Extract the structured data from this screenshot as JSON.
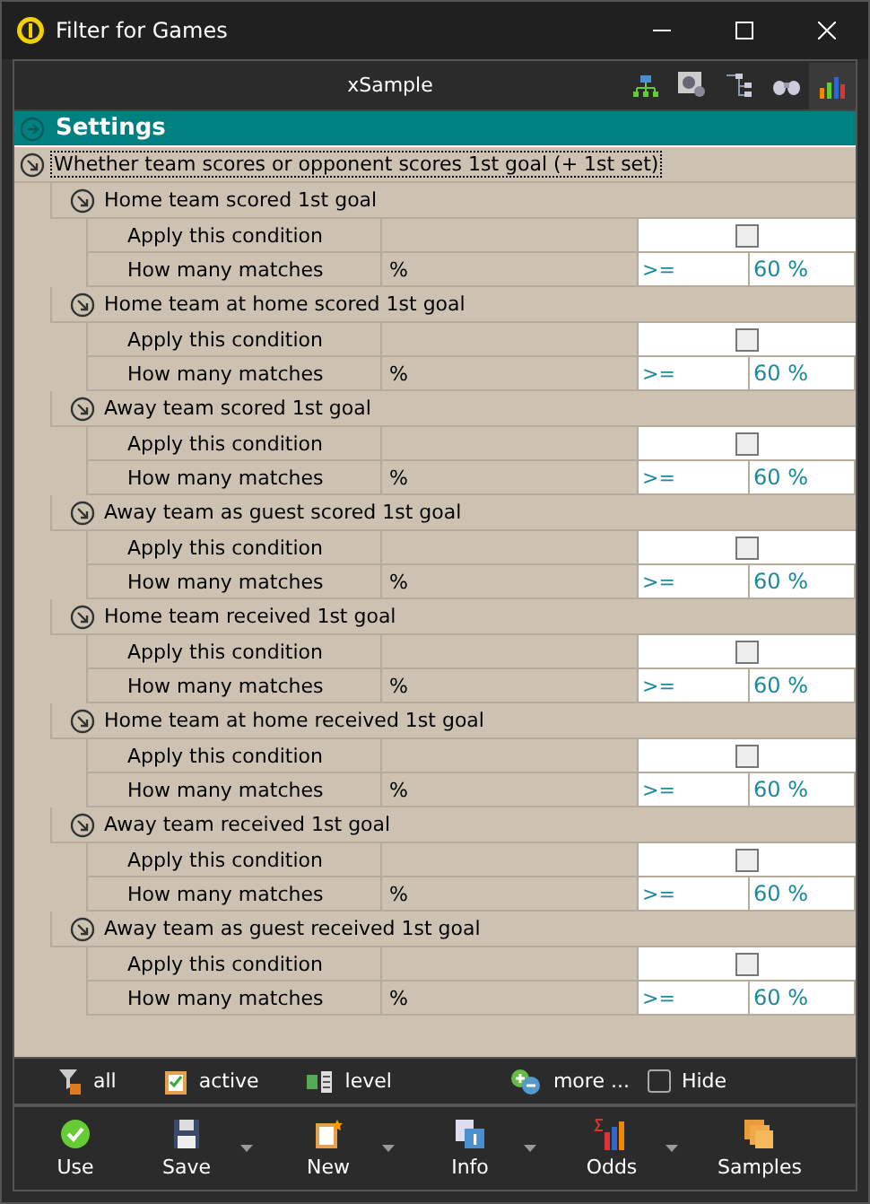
{
  "window": {
    "title": "Filter for Games"
  },
  "toolbar": {
    "title": "xSample"
  },
  "settings": {
    "title": "Settings",
    "group": {
      "title": "Whether team scores or opponent scores 1st goal (+ 1st set)",
      "conditions": [
        {
          "title": "Home team scored 1st goal",
          "apply_label": "Apply this condition",
          "checked": false,
          "matches_label": "How many matches",
          "unit": "%",
          "operator": ">=",
          "value": "60 %"
        },
        {
          "title": "Home team at home scored 1st goal",
          "apply_label": "Apply this condition",
          "checked": false,
          "matches_label": "How many matches",
          "unit": "%",
          "operator": ">=",
          "value": "60 %"
        },
        {
          "title": "Away team scored 1st goal",
          "apply_label": "Apply this condition",
          "checked": false,
          "matches_label": "How many matches",
          "unit": "%",
          "operator": ">=",
          "value": "60 %"
        },
        {
          "title": "Away team as guest scored 1st goal",
          "apply_label": "Apply this condition",
          "checked": false,
          "matches_label": "How many matches",
          "unit": "%",
          "operator": ">=",
          "value": "60 %"
        },
        {
          "title": "Home team received 1st goal",
          "apply_label": "Apply this condition",
          "checked": false,
          "matches_label": "How many matches",
          "unit": "%",
          "operator": ">=",
          "value": "60 %"
        },
        {
          "title": "Home team at home received 1st goal",
          "apply_label": "Apply this condition",
          "checked": false,
          "matches_label": "How many matches",
          "unit": "%",
          "operator": ">=",
          "value": "60 %"
        },
        {
          "title": "Away team received 1st goal",
          "apply_label": "Apply this condition",
          "checked": false,
          "matches_label": "How many matches",
          "unit": "%",
          "operator": ">=",
          "value": "60 %"
        },
        {
          "title": "Away team as guest received 1st goal",
          "apply_label": "Apply this condition",
          "checked": false,
          "matches_label": "How many matches",
          "unit": "%",
          "operator": ">=",
          "value": "60 %"
        }
      ]
    }
  },
  "filter_bar": {
    "items": [
      {
        "kind": "all",
        "label": "all"
      },
      {
        "kind": "active",
        "label": "active"
      },
      {
        "kind": "level",
        "label": "level"
      },
      {
        "kind": "more",
        "label": "more ..."
      }
    ],
    "hide": {
      "label": "Hide",
      "checked": false
    }
  },
  "actions": [
    {
      "kind": "use",
      "label": "Use",
      "dropdown": false
    },
    {
      "kind": "save",
      "label": "Save",
      "dropdown": true
    },
    {
      "kind": "new",
      "label": "New",
      "dropdown": true
    },
    {
      "kind": "info",
      "label": "Info",
      "dropdown": true
    },
    {
      "kind": "odds",
      "label": "Odds",
      "dropdown": true
    },
    {
      "kind": "samples",
      "label": "Samples",
      "dropdown": false
    }
  ]
}
